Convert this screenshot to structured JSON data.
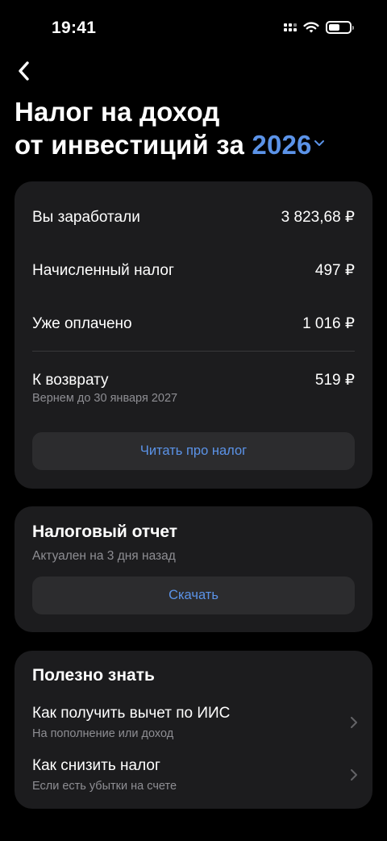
{
  "status_bar": {
    "time": "19:41"
  },
  "header": {
    "title_line1": "Налог на доход",
    "title_line2_prefix": "от инвестиций за",
    "year": "2026"
  },
  "summary": {
    "earned_label": "Вы заработали",
    "earned_value": "3 823,68 ₽",
    "tax_label": "Начисленный налог",
    "tax_value": "497 ₽",
    "paid_label": "Уже оплачено",
    "paid_value": "1 016 ₽",
    "refund_label": "К возврату",
    "refund_value": "519 ₽",
    "refund_note": "Вернем до 30 января 2027",
    "read_button": "Читать про налог"
  },
  "report": {
    "title": "Налоговый отчет",
    "status": "Актуален на 3 дня назад",
    "download_button": "Скачать"
  },
  "tips": {
    "title": "Полезно знать",
    "items": [
      {
        "title": "Как получить вычет по ИИС",
        "subtitle": "На пополнение или доход"
      },
      {
        "title": "Как снизить налог",
        "subtitle": "Если есть убытки на счете"
      }
    ]
  },
  "colors": {
    "accent": "#5b93e8",
    "card_bg": "#1c1c1e",
    "button_bg": "#2c2c2e",
    "secondary_text": "#8e8e93"
  }
}
